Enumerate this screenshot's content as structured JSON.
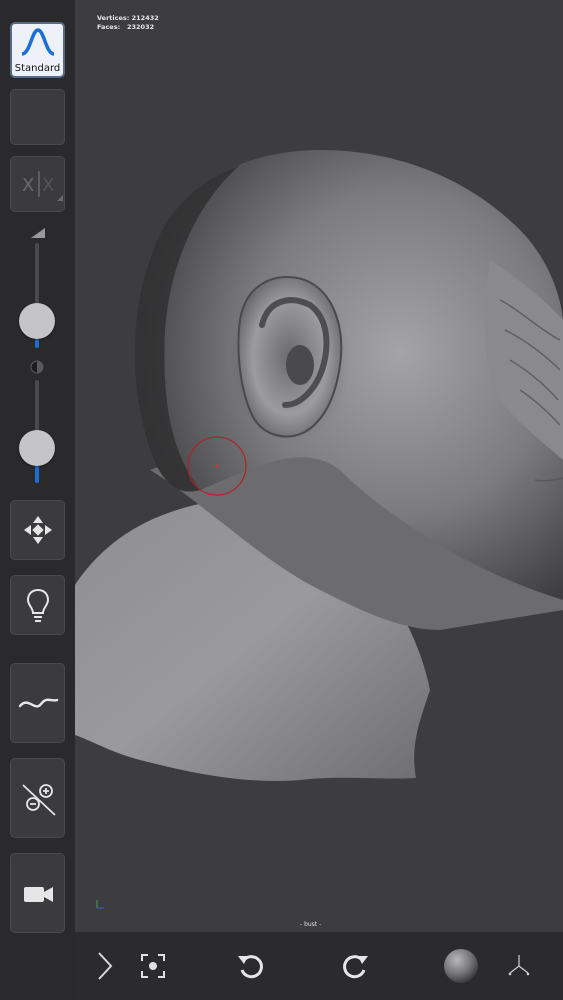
{
  "stats": {
    "vertices_label": "Vertices:",
    "vertices_value": "212432",
    "faces_label": "Faces:",
    "faces_value": "232032"
  },
  "mesh_name": "- bust -",
  "brush": {
    "label": "Standard"
  },
  "sliders": {
    "radius_fraction": 0.24,
    "strength_fraction": 0.2
  },
  "colors": {
    "accent": "#1a6fd6",
    "cursor": "#b0202a"
  },
  "icons": {
    "symmetry": "symmetry-icon",
    "transform": "move-arrows-icon",
    "light": "bulb-icon",
    "stroke": "stroke-curve-icon",
    "subdivision": "subdivide-plus-minus-icon",
    "camera": "video-camera-icon",
    "expand": "chevron-right-icon",
    "frame": "frame-focus-icon",
    "undo": "undo-icon",
    "redo": "redo-icon",
    "material": "matcap-sphere-icon",
    "axis": "axis-gizmo-icon"
  }
}
